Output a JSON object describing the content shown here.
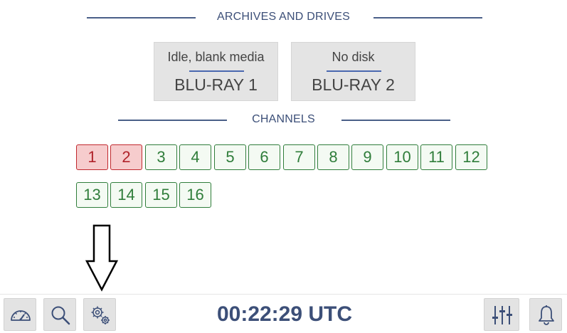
{
  "archives": {
    "title": "ARCHIVES AND DRIVES",
    "drives": [
      {
        "status": "Idle, blank media",
        "name": "BLU-RAY 1"
      },
      {
        "status": "No disk",
        "name": "BLU-RAY 2"
      }
    ]
  },
  "channels": {
    "title": "CHANNELS",
    "items": [
      {
        "label": "1",
        "state": "alarm"
      },
      {
        "label": "2",
        "state": "alarm"
      },
      {
        "label": "3",
        "state": "ok"
      },
      {
        "label": "4",
        "state": "ok"
      },
      {
        "label": "5",
        "state": "ok"
      },
      {
        "label": "6",
        "state": "ok"
      },
      {
        "label": "7",
        "state": "ok"
      },
      {
        "label": "8",
        "state": "ok"
      },
      {
        "label": "9",
        "state": "ok"
      },
      {
        "label": "10",
        "state": "ok"
      },
      {
        "label": "11",
        "state": "ok"
      },
      {
        "label": "12",
        "state": "ok"
      },
      {
        "label": "13",
        "state": "ok"
      },
      {
        "label": "14",
        "state": "ok"
      },
      {
        "label": "15",
        "state": "ok"
      },
      {
        "label": "16",
        "state": "ok"
      }
    ]
  },
  "footer": {
    "clock": "00:22:29 UTC",
    "buttons": {
      "dashboard": "speedometer-icon",
      "search": "search-icon",
      "settings": "gears-icon",
      "mixer": "sliders-icon",
      "notifications": "bell-icon"
    }
  },
  "colors": {
    "accent": "#3c4f78",
    "channel_ok": "#2f7d3a",
    "channel_alarm": "#c0282d"
  }
}
